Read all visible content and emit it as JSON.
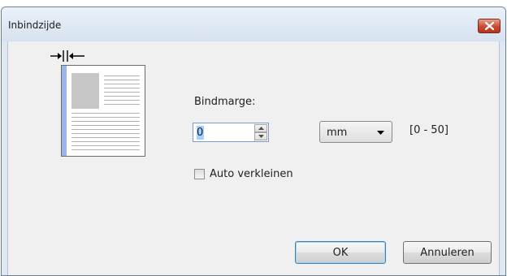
{
  "window": {
    "title": "Inbindzijde"
  },
  "title_bar": {
    "close_icon": "close-x-icon",
    "close_color": "#c74c34"
  },
  "illustration": {
    "icon": "binding-margin-icon",
    "margin_color": "#9db4ec"
  },
  "form": {
    "bindmarge_label": "Bindmarge:",
    "bindmarge_value": "0",
    "unit_selected": "mm",
    "range": "[0 - 50]",
    "auto_shrink_label": "Auto verkleinen",
    "auto_shrink_checked": false
  },
  "buttons": {
    "ok": "OK",
    "cancel": "Annuleren"
  }
}
